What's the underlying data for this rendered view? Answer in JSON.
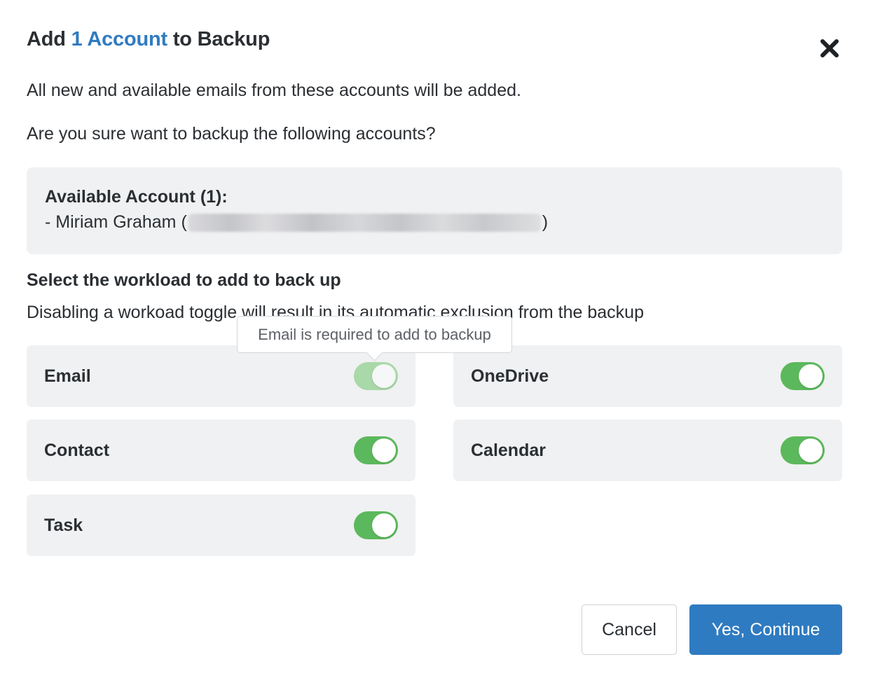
{
  "dialog": {
    "title_prefix": "Add",
    "title_count": "1",
    "title_accent_word": "Account",
    "title_suffix": "to Backup",
    "accent_color": "#2f7bc1",
    "close_icon": "close-icon"
  },
  "messages": {
    "line1": "All new and available emails from these accounts will be added.",
    "line2": "Are you sure want to backup the following accounts?"
  },
  "accounts": {
    "heading": "Available Account (1):",
    "items": [
      {
        "prefix": "- Miriam Graham (",
        "suffix": ")"
      }
    ]
  },
  "workload": {
    "title": "Select the workload to add to back up",
    "description": "Disabling a workoad toggle will result in its automatic exclusion from the backup",
    "tooltip": "Email is required to add to backup",
    "toggle_on_color": "#5cb85c",
    "items": [
      {
        "label": "Email",
        "enabled": true,
        "disabled": true
      },
      {
        "label": "OneDrive",
        "enabled": true,
        "disabled": false
      },
      {
        "label": "Contact",
        "enabled": true,
        "disabled": false
      },
      {
        "label": "Calendar",
        "enabled": true,
        "disabled": false
      },
      {
        "label": "Task",
        "enabled": true,
        "disabled": false
      }
    ]
  },
  "footer": {
    "cancel_label": "Cancel",
    "continue_label": "Yes, Continue"
  }
}
